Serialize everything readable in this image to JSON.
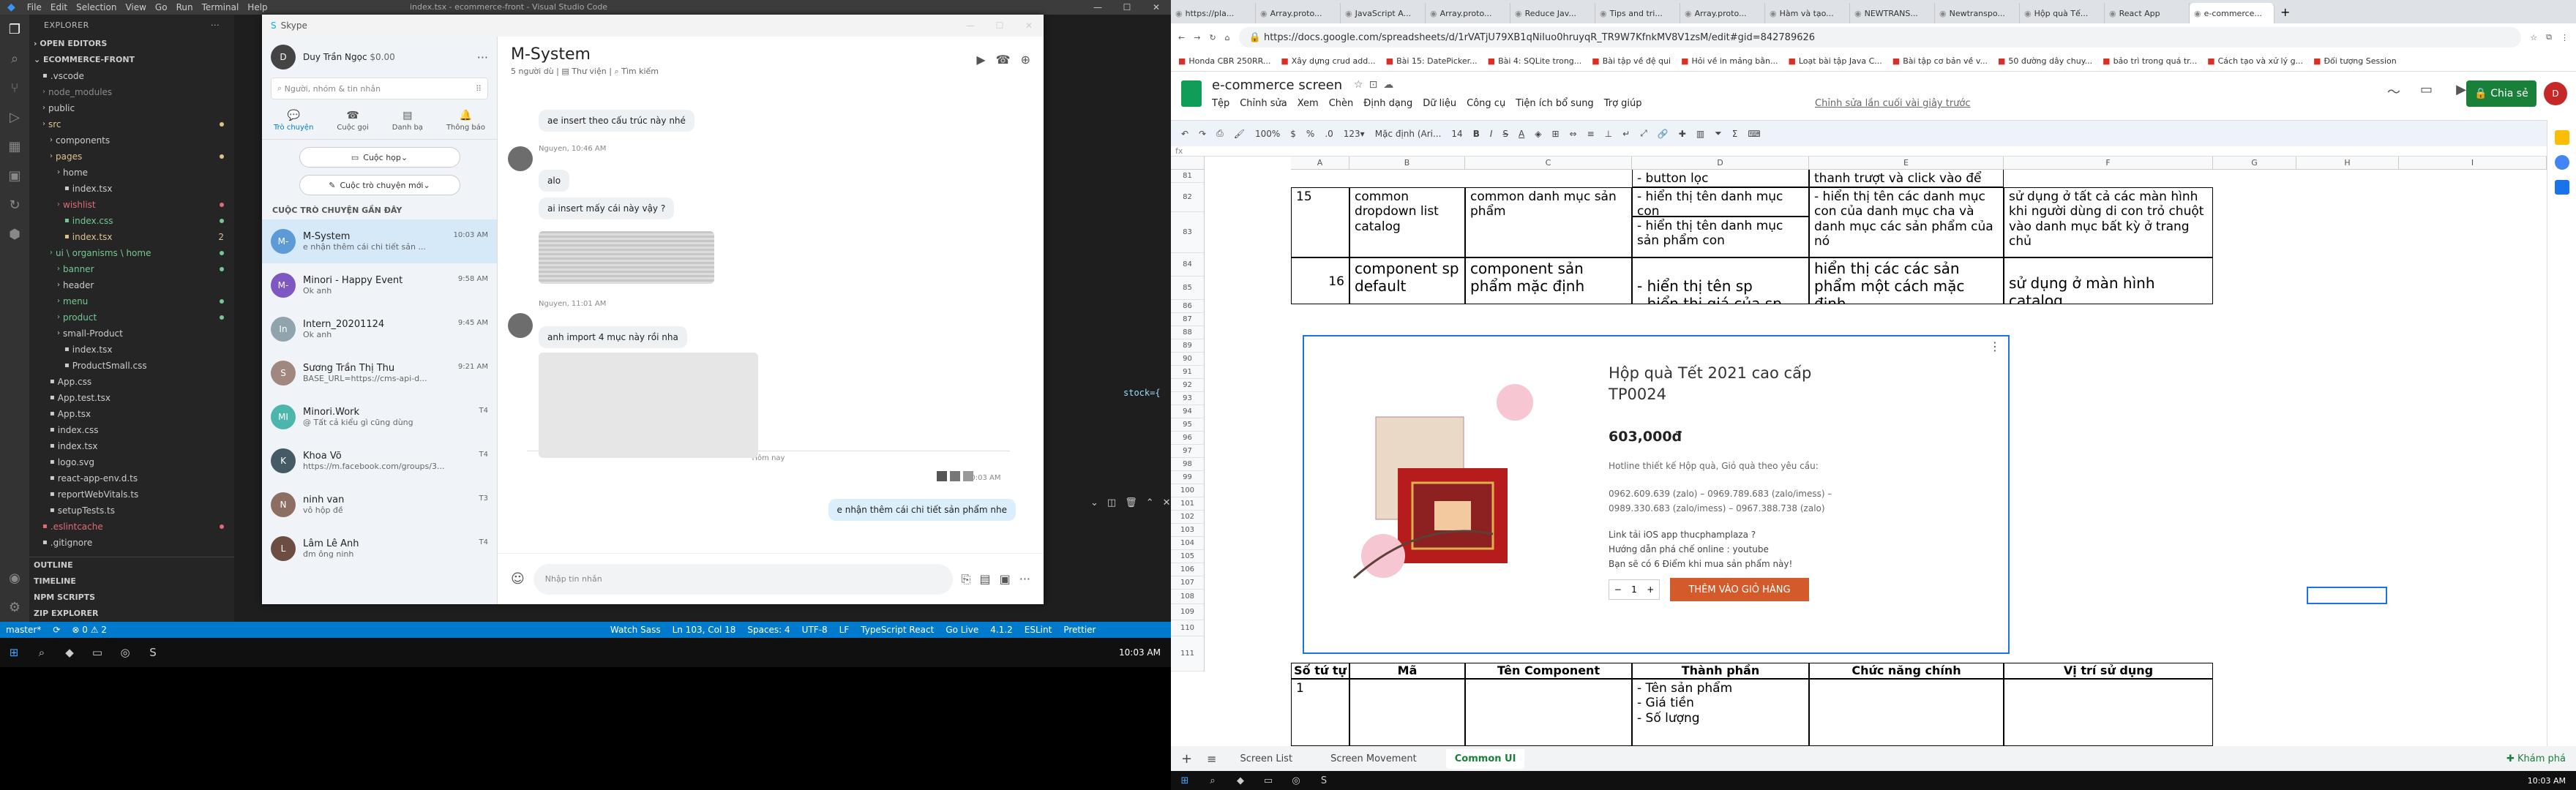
{
  "vscode": {
    "title": "index.tsx - ecommerce-front - Visual Studio Code",
    "menu": [
      "File",
      "Edit",
      "Selection",
      "View",
      "Go",
      "Run",
      "Terminal",
      "Help"
    ],
    "explorer_label": "EXPLORER",
    "open_editors": "OPEN EDITORS",
    "project": "ECOMMERCE-FRONT",
    "tree": [
      {
        "label": ".vscode",
        "depth": 1,
        "color": "#ccc"
      },
      {
        "label": "node_modules",
        "depth": 1,
        "color": "#8c8c8c"
      },
      {
        "label": "public",
        "depth": 1,
        "color": "#ccc"
      },
      {
        "label": "src",
        "depth": 1,
        "color": "#e2c08d"
      },
      {
        "label": "components",
        "depth": 2,
        "color": "#ccc"
      },
      {
        "label": "pages",
        "depth": 2,
        "color": "#e2c08d"
      },
      {
        "label": "home",
        "depth": 3,
        "color": "#ccc"
      },
      {
        "label": "index.tsx",
        "depth": 4,
        "color": "#ccc"
      },
      {
        "label": "wishlist",
        "depth": 3,
        "color": "#e06c75"
      },
      {
        "label": "index.css",
        "depth": 4,
        "color": "#73c991"
      },
      {
        "label": "index.tsx",
        "depth": 4,
        "color": "#e2c08d",
        "badge": "2"
      },
      {
        "label": "ui \\ organisms \\ home",
        "depth": 2,
        "color": "#73c991"
      },
      {
        "label": "banner",
        "depth": 3,
        "color": "#73c991"
      },
      {
        "label": "header",
        "depth": 3,
        "color": "#ccc"
      },
      {
        "label": "menu",
        "depth": 3,
        "color": "#73c991"
      },
      {
        "label": "product",
        "depth": 3,
        "color": "#73c991"
      },
      {
        "label": "small-Product",
        "depth": 3,
        "color": "#ccc"
      },
      {
        "label": "index.tsx",
        "depth": 4,
        "color": "#ccc"
      },
      {
        "label": "ProductSmall.css",
        "depth": 4,
        "color": "#ccc"
      },
      {
        "label": "App.css",
        "depth": 2,
        "color": "#ccc"
      },
      {
        "label": "App.test.tsx",
        "depth": 2,
        "color": "#ccc"
      },
      {
        "label": "App.tsx",
        "depth": 2,
        "color": "#ccc"
      },
      {
        "label": "index.css",
        "depth": 2,
        "color": "#ccc"
      },
      {
        "label": "index.tsx",
        "depth": 2,
        "color": "#ccc"
      },
      {
        "label": "logo.svg",
        "depth": 2,
        "color": "#ccc"
      },
      {
        "label": "react-app-env.d.ts",
        "depth": 2,
        "color": "#ccc"
      },
      {
        "label": "reportWebVitals.ts",
        "depth": 2,
        "color": "#ccc"
      },
      {
        "label": "setupTests.ts",
        "depth": 2,
        "color": "#ccc"
      },
      {
        "label": ".eslintcache",
        "depth": 1,
        "color": "#e06c75"
      },
      {
        "label": ".gitignore",
        "depth": 1,
        "color": "#ccc"
      }
    ],
    "sections": [
      "OUTLINE",
      "TIMELINE",
      "NPM SCRIPTS",
      "ZIP EXPLORER"
    ],
    "editor_snippet": "stock={",
    "status": {
      "branch": "master*",
      "errors": "⊗ 0 ⚠ 2",
      "watch": "Watch Sass",
      "cursor": "Ln 103, Col 18",
      "spaces": "Spaces: 4",
      "encoding": "UTF-8",
      "eol": "LF",
      "lang": "TypeScript React",
      "live": "Go Live",
      "version": "4.1.2",
      "eslint": "ESLint",
      "prettier": "Prettier"
    }
  },
  "skype": {
    "title": "Skype",
    "user": "Duy Trần Ngọc",
    "balance": "$0.00",
    "search_placeholder": "Người, nhóm & tin nhắn",
    "tabs": [
      "Trò chuyện",
      "Cuộc gọi",
      "Danh bạ",
      "Thông báo"
    ],
    "meet_button": "Cuộc họp",
    "new_chat_button": "Cuộc trò chuyện mới",
    "recent_label": "CUỘC TRÒ CHUYỆN GẦN ĐÂY",
    "conversations": [
      {
        "name": "M-System",
        "time": "10:03 AM",
        "msg": "e nhận thêm cái chi tiết sản ...",
        "initials": "M-"
      },
      {
        "name": "Minori - Happy Event",
        "time": "9:58 AM",
        "msg": "Ok anh",
        "initials": "M-"
      },
      {
        "name": "Intern_20201124",
        "time": "9:45 AM",
        "msg": "Ok anh",
        "initials": "In"
      },
      {
        "name": "Sương Trần Thị Thu",
        "time": "9:21 AM",
        "msg": "BASE_URL=https://cms-api-d...",
        "initials": "S"
      },
      {
        "name": "Minori.Work",
        "time": "T4",
        "msg": "@ Tất cả kiểu gì cũng dùng",
        "initials": "MI"
      },
      {
        "name": "Khoa Võ",
        "time": "T4",
        "msg": "https://m.facebook.com/groups/3...",
        "initials": "K"
      },
      {
        "name": "ninh van",
        "time": "T3",
        "msg": "vô hộp đề",
        "initials": "N"
      },
      {
        "name": "Lâm Lê Anh",
        "time": "T4",
        "msg": "đm ông ninh",
        "initials": "L"
      }
    ],
    "chat": {
      "title": "M-System",
      "sub_members": "5 người dù",
      "sub_gallery": "Thư viện",
      "sub_find": "Tìm kiếm",
      "messages": [
        {
          "who": "other",
          "text": "ae insert theo cấu trúc này nhé"
        },
        {
          "who": "meta",
          "text": "Nguyen, 10:46 AM"
        },
        {
          "who": "other",
          "text": "alo"
        },
        {
          "who": "other",
          "text": "ai insert mấy cái này vậy ?"
        },
        {
          "who": "meta",
          "text": "Nguyen, 11:01 AM"
        },
        {
          "who": "other",
          "text": "anh import 4 mục này rồi nha"
        },
        {
          "who": "divider",
          "text": "Hôm nay"
        },
        {
          "who": "meta",
          "text": "10:03 AM"
        },
        {
          "who": "me",
          "text": "e nhận thêm cái chi tiết sản phẩm nhe"
        }
      ],
      "input_placeholder": "Nhập tin nhắn"
    }
  },
  "chrome": {
    "tabs": [
      "https://pla...",
      "Array.proto...",
      "JavaScript A...",
      "Array.proto...",
      "Reduce Jav...",
      "Tips and tri...",
      "Array.proto...",
      "Hàm và tạo...",
      "NEWTRANS...",
      "Newtranspo...",
      "Hộp quà Tế...",
      "React App",
      "e-commerce..."
    ],
    "url": "https://docs.google.com/spreadsheets/d/1rVATjU79XB1qNiIuo0hruyqR_TR9W7KfnkMV8V1zsM/edit#gid=842789626",
    "bookmarks": [
      "Honda CBR 250RR...",
      "Xây dựng crud add...",
      "Bài 15: DatePicker...",
      "Bài 4: SQLite trong...",
      "Bài tập về đệ qui",
      "Hỏi về in mảng bằn...",
      "Loạt bài tập Java C...",
      "Bài tập cơ bản về v...",
      "50 đường dây chuy...",
      "bảo trì trong quá tr...",
      "Cách tạo và xử lý g...",
      "Đối tượng Session"
    ]
  },
  "sheets": {
    "doc_title": "e-commerce screen",
    "menus": [
      "Tệp",
      "Chỉnh sửa",
      "Xem",
      "Chèn",
      "Định dạng",
      "Dữ liệu",
      "Công cụ",
      "Tiện ích bổ sung",
      "Trợ giúp"
    ],
    "last_edit": "Chỉnh sửa lần cuối vài giây trước",
    "share": "Chia sẻ",
    "avatar": "D",
    "zoom": "100%",
    "font": "Mặc định (Ari...",
    "font_size": "14",
    "col_headers": [
      "A",
      "B",
      "C",
      "D",
      "E",
      "F",
      "G",
      "H",
      "I"
    ],
    "rows": {
      "r81_d": "- button lọc",
      "r81_e": "thanh trượt và click vào để lọc",
      "r82_a": "15",
      "r82_b": "common dropdown list catalog",
      "r82_c": "common danh mục sản phẩm",
      "r82_d1": "- hiển thị tên danh mục con",
      "r82_d2": "- hiển thị tên danh mục sản phẩm con",
      "r82_e": "- hiển thị tên các danh mục con của danh mục cha và danh mục các sản phẩm của nó",
      "r82_f": "sử dụng ở tất cả các màn hình khi người dùng di con trỏ chuột vào danh mục bất kỳ ở trang chủ",
      "r84_a": "16",
      "r84_b": "component sp default",
      "r84_c": "component sản phẩm mặc định",
      "r84_d1": "- hiển thị tên sp",
      "r84_d2": "- hiển thị giá của sp",
      "r84_e": "hiển thị các các sản phẩm một cách mặc định",
      "r84_f": "sử dụng ở màn hình catalog",
      "h108": [
        "Số tứ tự",
        "Mã",
        "Tên Component",
        "Thành phần",
        "Chức năng chính",
        "Vị trí sử dụng"
      ],
      "r109_a": "1",
      "r109_d": [
        "- Tên sản phẩm",
        "- Giá tiền",
        "- Số lượng"
      ]
    },
    "row_numbers": [
      "81",
      "82",
      "83",
      "84",
      "85",
      "86",
      "87",
      "88",
      "89",
      "90",
      "91",
      "92",
      "93",
      "94",
      "95",
      "96",
      "97",
      "98",
      "99",
      "100",
      "101",
      "102",
      "103",
      "104",
      "105",
      "106",
      "107",
      "108",
      "109",
      "110",
      "111"
    ],
    "embedded": {
      "title": "Hộp quà Tết 2021 cao cấp TP0024",
      "price": "603,000đ",
      "hotline": "Hotline thiết kế Hộp quà, Giỏ quà theo yêu cầu:",
      "phones1": "0962.609.639 (zalo) – 0969.789.683 (zalo/imess) –",
      "phones2": "0989.330.683 (zalo/imess) – 0967.388.738 (zalo)",
      "ios": "Link tải iOS app thucphamplaza ?",
      "guide": "Hướng dẫn phá chế online : youtube",
      "points": "Bạn sẽ có 6 Điểm khi mua sản phẩm này!",
      "qty": "1",
      "cart_button": "THÊM VÀO GIỎ HÀNG"
    },
    "sheet_tabs": [
      "Screen List",
      "Screen Movement",
      "Common UI"
    ],
    "explore": "Khám phá"
  },
  "clock": {
    "left": "10:03 AM",
    "right": "10:03 AM"
  },
  "colors": {
    "vs_status": "#007acc",
    "accent_green": "#188038",
    "cart_orange": "#d35a2a"
  }
}
